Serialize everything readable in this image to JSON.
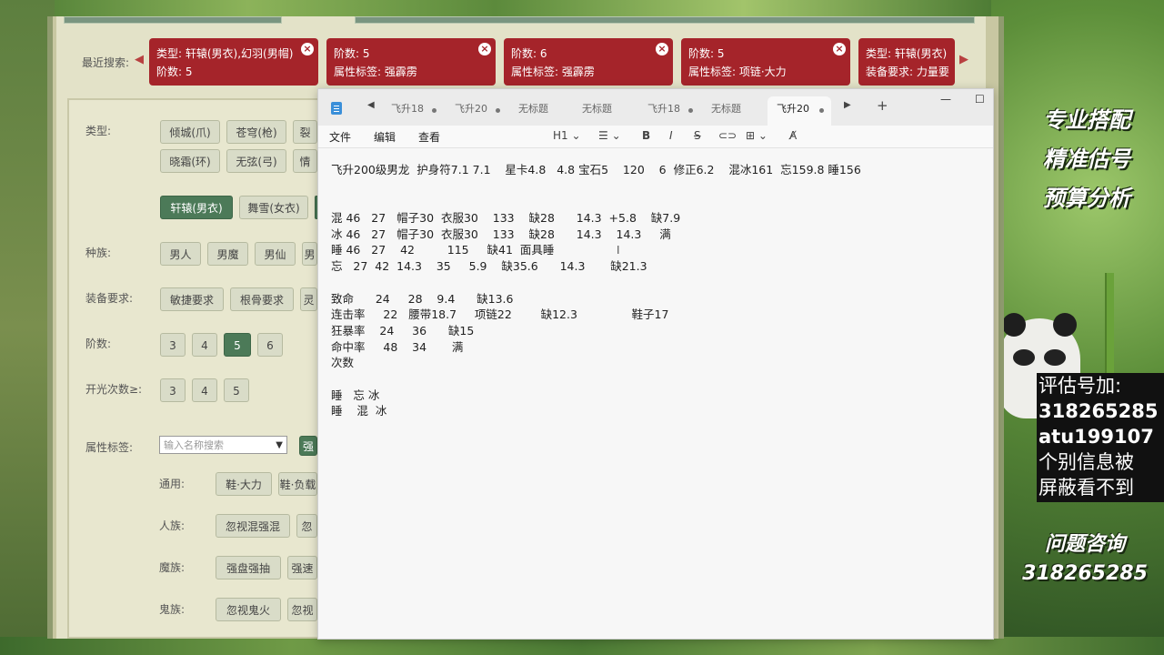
{
  "recent_search": {
    "label": "最近搜索:",
    "chips": [
      {
        "line1": "类型: 轩辕(男衣),幻羽(男帽)",
        "line2": "阶数: 5"
      },
      {
        "line1": "阶数: 5",
        "line2": "属性标签: 强霹雳"
      },
      {
        "line1": "阶数: 6",
        "line2": "属性标签: 强霹雳"
      },
      {
        "line1": "阶数: 5",
        "line2": "属性标签: 项链·大力"
      },
      {
        "line1": "类型: 轩辕(男衣)",
        "line2": "装备要求: 力量要"
      }
    ],
    "close_symbol": "×"
  },
  "filters": {
    "type_label": "类型:",
    "type_row1": [
      "倾城(爪)",
      "苍穹(枪)",
      "裂"
    ],
    "type_row2": [
      "晓霜(环)",
      "无弦(弓)",
      "情"
    ],
    "type_row3": [
      "轩辕(男衣)",
      "舞雪(女衣)"
    ],
    "race_label": "种族:",
    "races": [
      "男人",
      "男魔",
      "男仙",
      "男"
    ],
    "req_label": "装备要求:",
    "reqs": [
      "敏捷要求",
      "根骨要求",
      "灵"
    ],
    "tier_label": "阶数:",
    "tiers": [
      "3",
      "4",
      "5",
      "6"
    ],
    "tier_selected": "5",
    "light_label": "开光次数≥:",
    "lights": [
      "3",
      "4",
      "5"
    ],
    "attr_label": "属性标签:",
    "attr_placeholder": "输入名称搜索",
    "attr_btn": "强",
    "common_label": "通用:",
    "common": [
      "鞋·大力",
      "鞋·负载"
    ],
    "human_label": "人族:",
    "human": [
      "忽视混强混",
      "忽"
    ],
    "demon_label": "魔族:",
    "demon": [
      "强盘强抽",
      "强速"
    ],
    "ghost_label": "鬼族:",
    "ghost": [
      "忽视鬼火",
      "忽视"
    ]
  },
  "notepad": {
    "tabs": [
      "飞升18",
      "飞升20",
      "无标题",
      "无标题",
      "飞升18",
      "无标题",
      "飞升20"
    ],
    "active_tab": 6,
    "add_tab": "+",
    "menus": [
      "文件",
      "编辑",
      "查看"
    ],
    "heading_tool": "H1",
    "lines": [
      "飞升200级男龙  护身符7.1 7.1    星卡4.8   4.8 宝石5    120    6  修正6.2    混冰161  忘159.8 睡156",
      "",
      "",
      "混 46   27   帽子30  衣服30    133    缺28      14.3  +5.8    缺7.9",
      "冰 46   27   帽子30  衣服30    133    缺28      14.3    14.3     满",
      "睡 46   27    42         115     缺41  面具睡",
      "忘   27  42  14.3    35     5.9    缺35.6      14.3       缺21.3",
      "",
      "致命      24     28    9.4      缺13.6",
      "连击率     22   腰带18.7     项链22        缺12.3               鞋子17",
      "狂暴率    24     36      缺15",
      "命中率     48    34       满",
      "次数",
      "",
      "睡   忘 冰",
      "睡    混  冰"
    ]
  },
  "overlay": {
    "promo": [
      "专业搭配",
      "精准估号",
      "预算分析"
    ],
    "contact": [
      "评估号加:",
      "318265285",
      "atu199107",
      "个别信息被",
      "屏蔽看不到"
    ],
    "consult": [
      "问题咨询",
      "318265285"
    ]
  }
}
